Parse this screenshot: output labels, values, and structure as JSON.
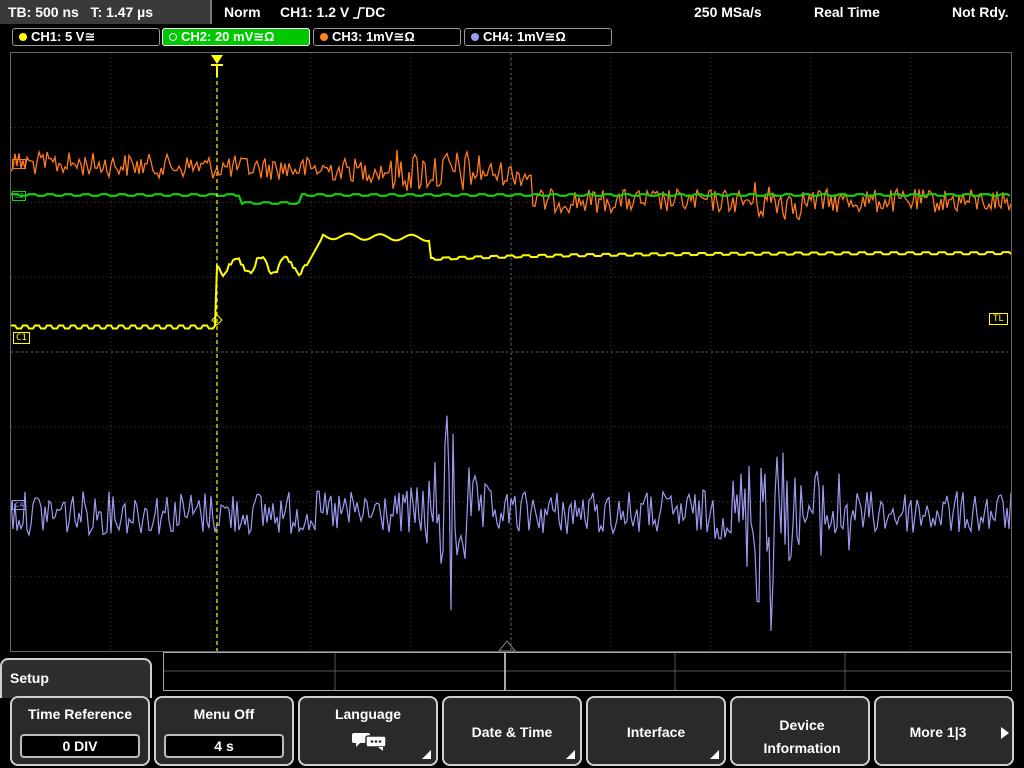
{
  "status": {
    "timebase": "TB: 500 ns",
    "time_offset": "T: 1.47 µs",
    "trigger_mode": "Norm",
    "trigger_info": "CH1: 1.2 V",
    "trigger_slope_coupling": "DC",
    "sample_rate": "250 MSa/s",
    "acq_mode": "Real Time",
    "state": "Not Rdy."
  },
  "channels": [
    {
      "label": "CH1: 5 V",
      "coupling": "≅",
      "color": "#ffff00",
      "active": false
    },
    {
      "label": "CH2: 20 mV",
      "coupling": "≅Ω",
      "color": "#00c800",
      "active": true
    },
    {
      "label": "CH3: 1mV",
      "coupling": "≅Ω",
      "color": "#ff8020",
      "active": false
    },
    {
      "label": "CH4: 1mV",
      "coupling": "≅Ω",
      "color": "#9a9af0",
      "active": false
    }
  ],
  "markers": {
    "ch1": "C1",
    "trigger_level": "TL",
    "ch2": "C2",
    "ch3": "C3",
    "ch4": "C4"
  },
  "menu": {
    "title": "Setup",
    "softkeys": [
      {
        "label": "Time Reference",
        "value": "0 DIV"
      },
      {
        "label": "Menu Off",
        "value": "4 s"
      },
      {
        "label": "Language",
        "value": ""
      },
      {
        "label": "Date & Time",
        "value": ""
      },
      {
        "label": "Interface",
        "value": ""
      },
      {
        "label": "Device Information",
        "value": ""
      },
      {
        "label": "More 1|3",
        "value": ""
      }
    ]
  },
  "icons": {
    "trigger_marker": "trigger-position-icon",
    "language": "speech-bubbles-icon",
    "more": "arrow-right-icon"
  }
}
